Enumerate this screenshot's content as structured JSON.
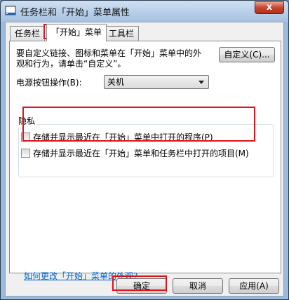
{
  "window": {
    "title": "任务栏和「开始」菜单属性",
    "close_label": "x"
  },
  "tabs": [
    {
      "label": "任务栏",
      "active": false
    },
    {
      "label": "「开始」菜单",
      "active": true
    },
    {
      "label": "工具栏",
      "active": false
    }
  ],
  "start_menu": {
    "description": "要自定义链接、图标和菜单在「开始」菜单中的外观和行为，请单击“自定义”。",
    "customize_label": "自定义(C)...",
    "power_label": "电源按钮操作(B):",
    "power_value": "关机",
    "privacy_title": "隐私",
    "privacy_options": [
      {
        "label": "存储并显示最近在「开始」菜单中打开的程序(P)",
        "checked": false
      },
      {
        "label": "存储并显示最近在「开始」菜单和任务栏中打开的项目(M)",
        "checked": false
      }
    ],
    "help_link": "如何更改「开始」菜单的外观?"
  },
  "buttons": {
    "ok": "确定",
    "cancel": "取消",
    "apply": "应用(A)"
  },
  "highlight_color": "#e0131b"
}
